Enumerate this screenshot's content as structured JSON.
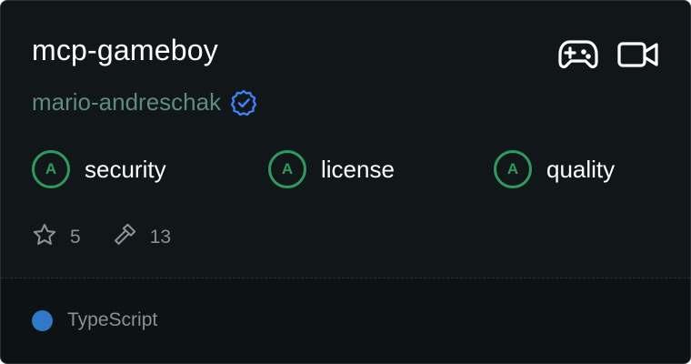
{
  "server": {
    "name": "mcp-gameboy",
    "author": "mario-andreschak",
    "verified_icon": "verified-badge-icon"
  },
  "top_icons": [
    "gamepad-icon",
    "video-camera-icon"
  ],
  "scores": [
    {
      "grade": "A",
      "label": "security"
    },
    {
      "grade": "A",
      "label": "license"
    },
    {
      "grade": "A",
      "label": "quality"
    }
  ],
  "stats": {
    "stars": "5",
    "tools": "13"
  },
  "language": {
    "name": "TypeScript",
    "color": "#3178c6"
  },
  "colors": {
    "background": "#111618",
    "footer_background": "#0d1214",
    "grade": "#2e9a5e",
    "author": "#5f8a7e",
    "verified": "#3b82f6",
    "muted": "#8a9196"
  }
}
